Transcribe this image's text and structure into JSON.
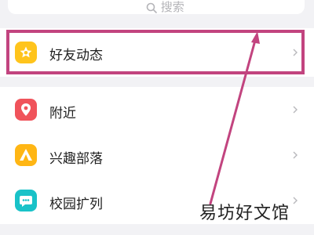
{
  "search": {
    "label": "搜索",
    "icon": "search-icon"
  },
  "menu": {
    "items": [
      {
        "label": "好友动态",
        "icon": "star-badge-icon",
        "color": "#ffc41c"
      },
      {
        "label": "附近",
        "icon": "location-pin-icon",
        "color": "#f0535b"
      },
      {
        "label": "兴趣部落",
        "icon": "tent-icon",
        "color": "#ffb614"
      },
      {
        "label": "校园扩列",
        "icon": "campus-chat-icon",
        "color": "#19c2c8"
      }
    ]
  },
  "annotation": {
    "highlight_color": "#c2447f"
  },
  "watermark": "易坊好文馆"
}
